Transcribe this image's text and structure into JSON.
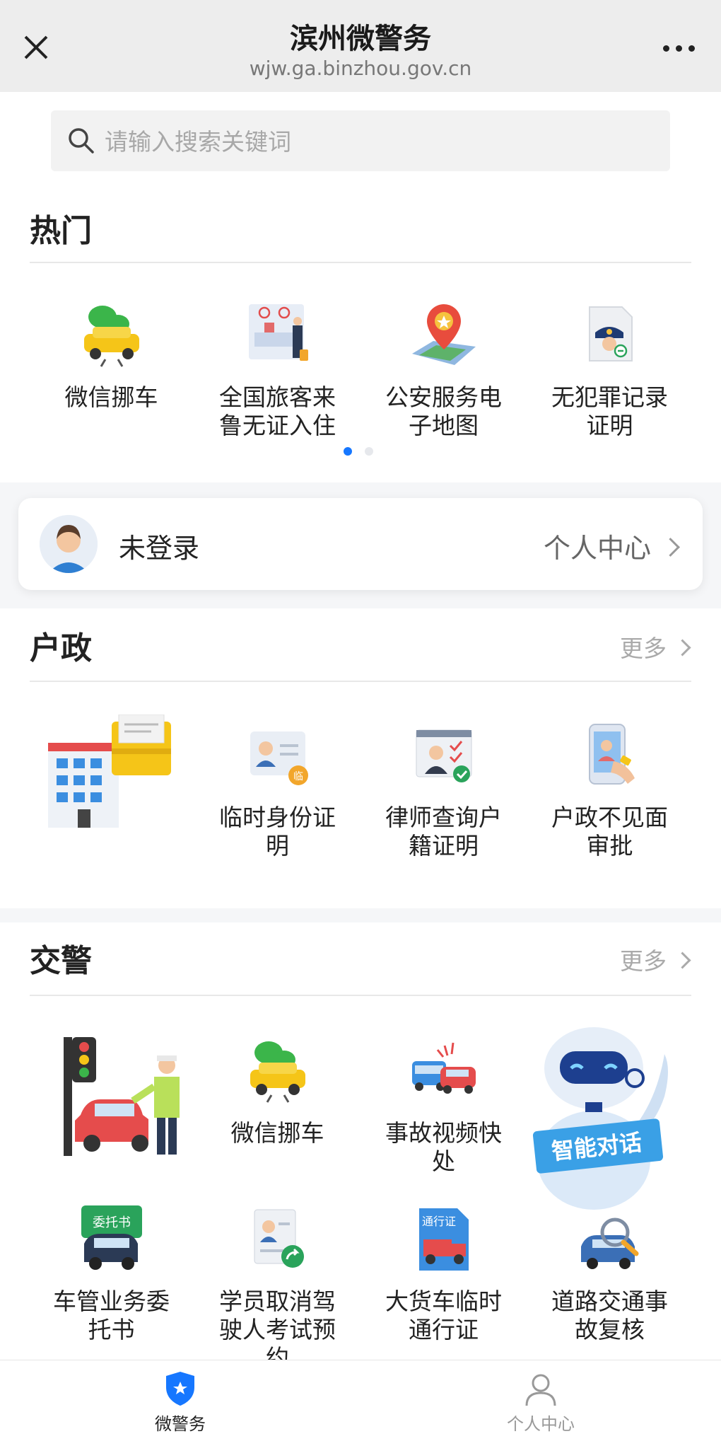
{
  "header": {
    "title": "滨州微警务",
    "url": "wjw.ga.binzhou.gov.cn"
  },
  "search": {
    "placeholder": "请输入搜索关键词"
  },
  "hot": {
    "title": "热门",
    "items": [
      {
        "label": "微信挪车",
        "icon": "car-wechat-icon"
      },
      {
        "label": "全国旅客来鲁无证入住",
        "icon": "hotel-checkin-icon"
      },
      {
        "label": "公安服务电子地图",
        "icon": "map-pin-icon"
      },
      {
        "label": "无犯罪记录证明",
        "icon": "police-certificate-icon"
      }
    ],
    "pager": {
      "pages": 2,
      "current": 1
    }
  },
  "login": {
    "status": "未登录",
    "link": "个人中心"
  },
  "huzheng": {
    "title": "户政",
    "more": "更多",
    "items": [
      {
        "label": "",
        "icon": "building-banner-icon"
      },
      {
        "label": "临时身份证明",
        "icon": "temp-id-icon"
      },
      {
        "label": "律师查询户籍证明",
        "icon": "lawyer-query-icon"
      },
      {
        "label": "户政不见面审批",
        "icon": "remote-approval-icon"
      }
    ]
  },
  "jiaojing": {
    "title": "交警",
    "more": "更多",
    "items": [
      {
        "label": "",
        "icon": "traffic-police-banner-icon"
      },
      {
        "label": "微信挪车",
        "icon": "car-wechat-icon"
      },
      {
        "label": "事故视频快处",
        "icon": "accident-video-icon"
      },
      {
        "label": "",
        "icon": "robot-obscured-icon"
      },
      {
        "label": "车管业务委托书",
        "icon": "entrust-icon"
      },
      {
        "label": "学员取消驾驶人考试预约",
        "icon": "exam-cancel-icon"
      },
      {
        "label": "大货车临时通行证",
        "icon": "truck-pass-icon"
      },
      {
        "label": "道路交通事故复核",
        "icon": "accident-review-icon"
      }
    ]
  },
  "robot": {
    "label": "智能对话"
  },
  "tabbar": [
    {
      "label": "微警务",
      "icon": "shield-star-icon",
      "active": true
    },
    {
      "label": "个人中心",
      "icon": "user-icon",
      "active": false
    }
  ],
  "colors": {
    "accent": "#1677ff",
    "tab_inactive": "#999999",
    "divider": "#e8e8e8"
  }
}
